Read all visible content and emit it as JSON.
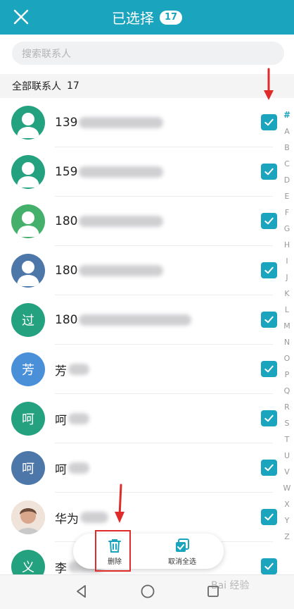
{
  "header": {
    "title": "已选择",
    "selected_count": "17",
    "close_icon": "close-icon",
    "background": "#1aa4be"
  },
  "search": {
    "placeholder": "搜索联系人"
  },
  "section": {
    "label": "全部联系人",
    "count": "17"
  },
  "contacts": [
    {
      "avatar_type": "person",
      "avatar_color": "#24a27f",
      "name_visible": "139",
      "checked": true
    },
    {
      "avatar_type": "person",
      "avatar_color": "#24a27f",
      "name_visible": "159",
      "checked": true
    },
    {
      "avatar_type": "person",
      "avatar_color": "#45b06c",
      "name_visible": "180",
      "checked": true
    },
    {
      "avatar_type": "person",
      "avatar_color": "#4c77a8",
      "name_visible": "180",
      "checked": true
    },
    {
      "avatar_type": "text",
      "avatar_text": "过",
      "avatar_color": "#24a27f",
      "name_visible": "180",
      "checked": true
    },
    {
      "avatar_type": "text",
      "avatar_text": "芳",
      "avatar_color": "#4a90d9",
      "name_visible": "芳",
      "checked": true
    },
    {
      "avatar_type": "text",
      "avatar_text": "呵",
      "avatar_color": "#24a27f",
      "name_visible": "呵",
      "checked": true
    },
    {
      "avatar_type": "text",
      "avatar_text": "呵",
      "avatar_color": "#4c77a8",
      "name_visible": "呵",
      "checked": true
    },
    {
      "avatar_type": "photo",
      "avatar_color": "#e8d2c4",
      "name_visible": "华为",
      "checked": true
    },
    {
      "avatar_type": "text",
      "avatar_text": "义",
      "avatar_color": "#24a27f",
      "name_visible": "李",
      "checked": true
    }
  ],
  "alphabet_index": [
    "#",
    "A",
    "B",
    "C",
    "D",
    "E",
    "F",
    "G",
    "H",
    "I",
    "J",
    "K",
    "L",
    "M",
    "N",
    "O",
    "P",
    "Q",
    "R",
    "S",
    "T",
    "U",
    "V",
    "W",
    "X",
    "Y",
    "Z"
  ],
  "actions": {
    "delete_label": "删除",
    "deselect_all_label": "取消全选",
    "delete_icon": "trash-icon",
    "deselect_icon": "deselect-all-icon"
  },
  "nav": {
    "back_icon": "back-triangle-icon",
    "home_icon": "home-circle-icon",
    "recent_icon": "recent-square-icon"
  },
  "watermark": "Bai 经验"
}
